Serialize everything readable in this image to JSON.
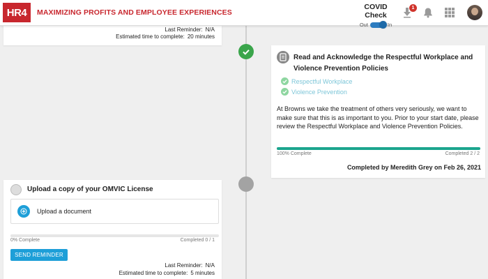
{
  "header": {
    "logo_text": "HR4",
    "tagline": "MAXIMIZING PROFITS AND EMPLOYEE EXPERIENCES",
    "covid": {
      "title": "COVID Check",
      "off_label": "Out",
      "on_label": "In",
      "state": "In"
    },
    "notification_count": "1",
    "icons": [
      "download-icon",
      "bell-icon",
      "apps-grid-icon",
      "user-avatar"
    ]
  },
  "top_card": {
    "last_reminder_label": "Last Reminder:",
    "last_reminder_value": "N/A",
    "est_time_label": "Estimated time to complete:",
    "est_time_value": "20 minutes"
  },
  "task_respect": {
    "title": "Read and Acknowledge the Respectful Workplace and Violence Prevention Policies",
    "items": [
      "Respectful Workplace",
      "Violence Prevention"
    ],
    "description": "At Browns we take the treatment of others very seriously, we want to make sure that this is as important to you. Prior to your start date, please review the Respectful Workplace and Violence Prevention Policies.",
    "progress_percent": 100,
    "progress_label": "100% Complete",
    "completed_count": "Completed 2 / 2",
    "completed_by": "Completed by Meredith Grey on Feb 26, 2021"
  },
  "task_upload": {
    "title": "Upload a copy of your OMVIC License",
    "upload_label": "Upload a document",
    "progress_percent": 0,
    "progress_label": "0% Complete",
    "completed_count": "Completed 0 / 1",
    "send_button": "SEND REMINDER",
    "last_reminder_label": "Last Reminder:",
    "last_reminder_value": "N/A",
    "est_time_label": "Estimated time to complete:",
    "est_time_value": "5 minutes"
  },
  "colors": {
    "brand_red": "#c8272e",
    "success_green": "#3aa54b",
    "progress_teal": "#1ba58e",
    "action_blue": "#1e9fd8",
    "pending_gray": "#a3a3a3"
  }
}
